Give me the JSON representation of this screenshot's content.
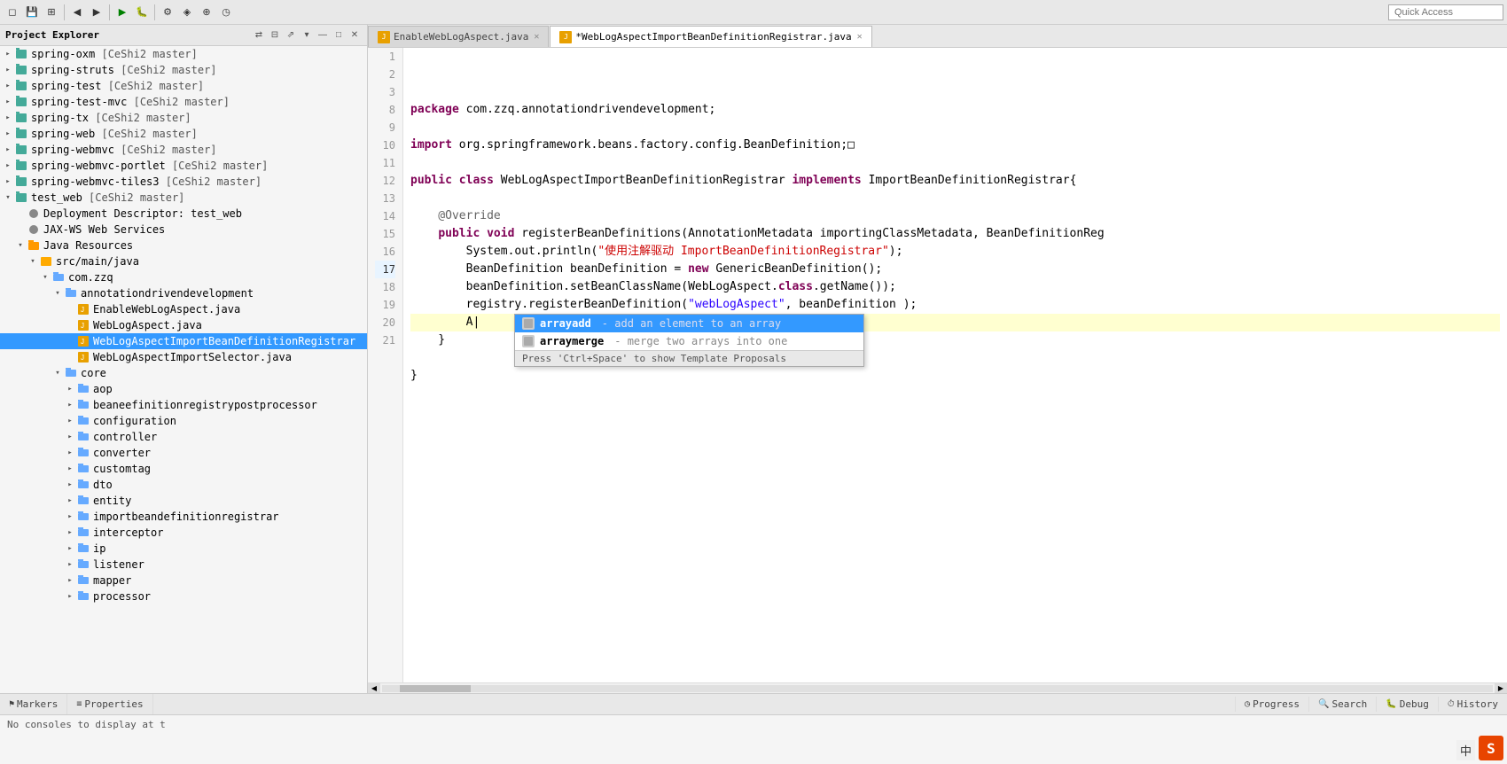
{
  "toolbar": {
    "quick_access_placeholder": "Quick Access",
    "buttons": [
      "save-all",
      "new",
      "open",
      "refresh",
      "back",
      "forward",
      "run",
      "debug",
      "profile"
    ]
  },
  "project_explorer": {
    "title": "Project Explorer",
    "items": [
      {
        "id": "spring-oxm",
        "label": "spring-oxm",
        "branch": "[CeShi2 master]",
        "indent": 0,
        "type": "project",
        "expanded": false
      },
      {
        "id": "spring-struts",
        "label": "spring-struts",
        "branch": "[CeShi2 master]",
        "indent": 0,
        "type": "project",
        "expanded": false
      },
      {
        "id": "spring-test",
        "label": "spring-test",
        "branch": "[CeShi2 master]",
        "indent": 0,
        "type": "project",
        "expanded": false
      },
      {
        "id": "spring-test-mvc",
        "label": "spring-test-mvc",
        "branch": "[CeShi2 master]",
        "indent": 0,
        "type": "project",
        "expanded": false
      },
      {
        "id": "spring-tx",
        "label": "spring-tx",
        "branch": "[CeShi2 master]",
        "indent": 0,
        "type": "project",
        "expanded": false
      },
      {
        "id": "spring-web",
        "label": "spring-web",
        "branch": "[CeShi2 master]",
        "indent": 0,
        "type": "project",
        "expanded": false
      },
      {
        "id": "spring-webmvc",
        "label": "spring-webmvc",
        "branch": "[CeShi2 master]",
        "indent": 0,
        "type": "project",
        "expanded": false
      },
      {
        "id": "spring-webmvc-portlet",
        "label": "spring-webmvc-portlet",
        "branch": "[CeShi2 master]",
        "indent": 0,
        "type": "project",
        "expanded": false
      },
      {
        "id": "spring-webmvc-tiles3",
        "label": "spring-webmvc-tiles3",
        "branch": "[CeShi2 master]",
        "indent": 0,
        "type": "project",
        "expanded": false
      },
      {
        "id": "test_web",
        "label": "test_web",
        "branch": "[CeShi2 master]",
        "indent": 0,
        "type": "project",
        "expanded": true
      },
      {
        "id": "deployment-descriptor",
        "label": "Deployment Descriptor: test_web",
        "indent": 1,
        "type": "config",
        "expanded": false
      },
      {
        "id": "jax-ws",
        "label": "JAX-WS Web Services",
        "indent": 1,
        "type": "config",
        "expanded": false
      },
      {
        "id": "java-resources",
        "label": "Java Resources",
        "indent": 1,
        "type": "folder",
        "expanded": true
      },
      {
        "id": "src-main-java",
        "label": "src/main/java",
        "indent": 2,
        "type": "src-folder",
        "expanded": true
      },
      {
        "id": "com-zzq",
        "label": "com.zzq",
        "indent": 3,
        "type": "package",
        "expanded": true
      },
      {
        "id": "annotationdrivendevelopment",
        "label": "annotationdrivendevelopment",
        "indent": 4,
        "type": "package",
        "expanded": true
      },
      {
        "id": "EnableWebLogAspect-java",
        "label": "EnableWebLogAspect.java",
        "indent": 5,
        "type": "java",
        "expanded": false
      },
      {
        "id": "WebLogAspect-java",
        "label": "WebLogAspect.java",
        "indent": 5,
        "type": "java",
        "expanded": false
      },
      {
        "id": "WebLogAspectImportBeanDefinitionRegistrar-java",
        "label": "WebLogAspectImportBeanDefinitionRegistrar",
        "indent": 5,
        "type": "java",
        "expanded": false,
        "selected": true
      },
      {
        "id": "WebLogAspectImportSelector-java",
        "label": "WebLogAspectImportSelector.java",
        "indent": 5,
        "type": "java",
        "expanded": false
      },
      {
        "id": "core",
        "label": "core",
        "indent": 4,
        "type": "package",
        "expanded": true
      },
      {
        "id": "aop",
        "label": "aop",
        "indent": 5,
        "type": "package",
        "expanded": false
      },
      {
        "id": "beaneefinitionregistrypostprocessor",
        "label": "beaneefinitionregistrypostprocessor",
        "indent": 5,
        "type": "package",
        "expanded": false
      },
      {
        "id": "configuration",
        "label": "configuration",
        "indent": 5,
        "type": "package",
        "expanded": false
      },
      {
        "id": "controller",
        "label": "controller",
        "indent": 5,
        "type": "package",
        "expanded": false
      },
      {
        "id": "converter",
        "label": "converter",
        "indent": 5,
        "type": "package",
        "expanded": false
      },
      {
        "id": "customtag",
        "label": "customtag",
        "indent": 5,
        "type": "package",
        "expanded": false
      },
      {
        "id": "dto",
        "label": "dto",
        "indent": 5,
        "type": "package",
        "expanded": false
      },
      {
        "id": "entity",
        "label": "entity",
        "indent": 5,
        "type": "package",
        "expanded": false
      },
      {
        "id": "importbeandefinitionregistrar",
        "label": "importbeandefinitionregistrar",
        "indent": 5,
        "type": "package",
        "expanded": false
      },
      {
        "id": "interceptor",
        "label": "interceptor",
        "indent": 5,
        "type": "package",
        "expanded": false
      },
      {
        "id": "ip",
        "label": "ip",
        "indent": 5,
        "type": "package",
        "expanded": false
      },
      {
        "id": "listener",
        "label": "listener",
        "indent": 5,
        "type": "package",
        "expanded": false
      },
      {
        "id": "mapper",
        "label": "mapper",
        "indent": 5,
        "type": "package",
        "expanded": false
      },
      {
        "id": "processor",
        "label": "processor",
        "indent": 5,
        "type": "package",
        "expanded": false
      }
    ]
  },
  "editor": {
    "tabs": [
      {
        "id": "tab1",
        "label": "EnableWebLogAspect.java",
        "active": false,
        "modified": false
      },
      {
        "id": "tab2",
        "label": "*WebLogAspectImportBeanDefinitionRegistrar.java",
        "active": true,
        "modified": true
      }
    ],
    "lines": [
      {
        "num": 1,
        "content": "package com.zzq.annotationdrivendevelopment;",
        "tokens": [
          {
            "text": "package",
            "cls": "kw"
          },
          {
            "text": " com.zzq.annotationdrivendevelopment;",
            "cls": ""
          }
        ]
      },
      {
        "num": 2,
        "content": "",
        "tokens": []
      },
      {
        "num": 3,
        "content": "import org.springframework.beans.factory.config.BeanDefinition;",
        "tokens": [
          {
            "text": "import",
            "cls": "kw"
          },
          {
            "text": " org.springframework.beans.factory.config.BeanDefinition;",
            "cls": ""
          }
        ]
      },
      {
        "num": 8,
        "content": "",
        "tokens": []
      },
      {
        "num": 9,
        "content": "public class WebLogAspectImportBeanDefinitionRegistrar implements ImportBeanDefinitionRegistrar{",
        "tokens": [
          {
            "text": "public",
            "cls": "kw"
          },
          {
            "text": " ",
            "cls": ""
          },
          {
            "text": "class",
            "cls": "kw"
          },
          {
            "text": " WebLogAspectImportBeanDefinitionRegistrar ",
            "cls": ""
          },
          {
            "text": "implements",
            "cls": "kw"
          },
          {
            "text": " ImportBeanDefinitionRegistrar{",
            "cls": ""
          }
        ]
      },
      {
        "num": 10,
        "content": "",
        "tokens": []
      },
      {
        "num": 11,
        "content": "    @Override",
        "tokens": [
          {
            "text": "    @Override",
            "cls": "annot"
          }
        ]
      },
      {
        "num": 12,
        "content": "    public void registerBeanDefinitions(AnnotationMetadata importingClassMetadata, BeanDefinitionReg",
        "tokens": [
          {
            "text": "    ",
            "cls": ""
          },
          {
            "text": "public",
            "cls": "kw"
          },
          {
            "text": " ",
            "cls": ""
          },
          {
            "text": "void",
            "cls": "kw"
          },
          {
            "text": " registerBeanDefinitions(AnnotationMetadata importingClassMetadata, BeanDefinitionReg",
            "cls": ""
          }
        ]
      },
      {
        "num": 13,
        "content": "        System.out.println(\"使用注解驱动 ImportBeanDefinitionRegistrar\");",
        "tokens": [
          {
            "text": "        System.out.println(",
            "cls": ""
          },
          {
            "text": "\"使用注解驱动 ImportBeanDefinitionRegistrar\"",
            "cls": "str-cn"
          },
          {
            "text": ");",
            "cls": ""
          }
        ]
      },
      {
        "num": 14,
        "content": "        BeanDefinition beanDefinition = new GenericBeanDefinition();",
        "tokens": [
          {
            "text": "        BeanDefinition beanDefinition = ",
            "cls": ""
          },
          {
            "text": "new",
            "cls": "kw"
          },
          {
            "text": " GenericBeanDefinition();",
            "cls": ""
          }
        ]
      },
      {
        "num": 15,
        "content": "        beanDefinition.setBeanClassName(WebLogAspect.class.getName());",
        "tokens": [
          {
            "text": "        beanDefinition.setBeanClassName(WebLogAspect.",
            "cls": ""
          },
          {
            "text": "class",
            "cls": "kw"
          },
          {
            "text": ".getName());",
            "cls": ""
          }
        ]
      },
      {
        "num": 16,
        "content": "        registry.registerBeanDefinition(\"webLogAspect\", beanDefinition );",
        "tokens": [
          {
            "text": "        registry.registerBeanDefinition(",
            "cls": ""
          },
          {
            "text": "\"webLogAspect\"",
            "cls": "str"
          },
          {
            "text": ", beanDefinition );",
            "cls": ""
          }
        ]
      },
      {
        "num": 17,
        "content": "        A|",
        "tokens": [
          {
            "text": "        A",
            "cls": ""
          },
          {
            "text": "|",
            "cls": "cursor"
          }
        ],
        "current": true
      },
      {
        "num": 18,
        "content": "    }",
        "tokens": [
          {
            "text": "    }",
            "cls": ""
          }
        ]
      },
      {
        "num": 19,
        "content": "",
        "tokens": []
      },
      {
        "num": 20,
        "content": "}",
        "tokens": [
          {
            "text": "}",
            "cls": ""
          }
        ]
      },
      {
        "num": 21,
        "content": "",
        "tokens": []
      }
    ],
    "autocomplete": {
      "items": [
        {
          "id": "ac1",
          "keyword": "arrayadd",
          "desc": "add an element to an array",
          "selected": true
        },
        {
          "id": "ac2",
          "keyword": "arraymerge",
          "desc": "merge two arrays into one",
          "selected": false
        }
      ],
      "hint": "Press 'Ctrl+Space' to show Template Proposals"
    }
  },
  "bottom_panel": {
    "tabs_left": [
      {
        "id": "markers",
        "label": "Markers",
        "icon": "⚑"
      },
      {
        "id": "properties",
        "label": "Properties",
        "icon": "≡"
      }
    ],
    "tabs_right": [
      {
        "id": "progress",
        "label": "Progress",
        "icon": "◷"
      },
      {
        "id": "search",
        "label": "Search",
        "icon": "🔍"
      },
      {
        "id": "debug",
        "label": "Debug",
        "icon": "🐛"
      },
      {
        "id": "history",
        "label": "History",
        "icon": "⏱"
      }
    ],
    "content": "No consoles to display at t"
  },
  "status_bar": {
    "spring_icon": "S",
    "cn_label": "中"
  }
}
